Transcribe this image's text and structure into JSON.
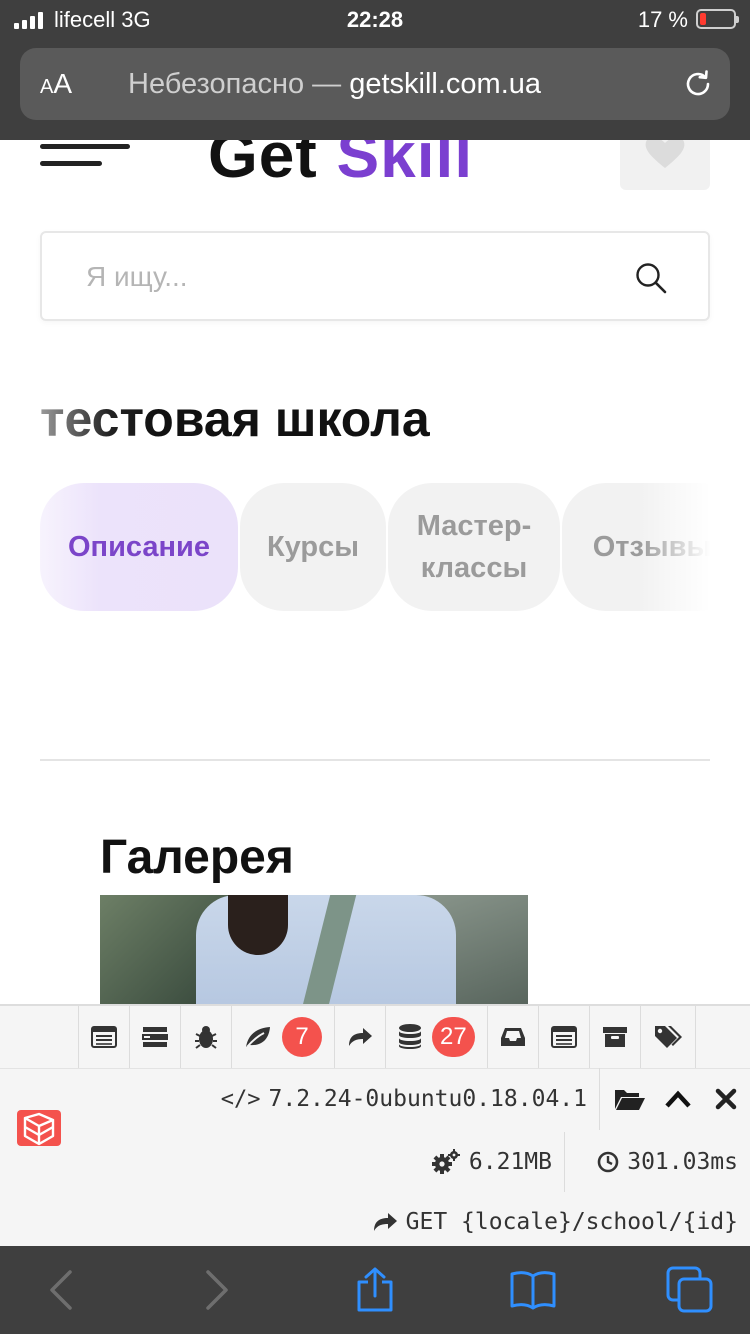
{
  "status_bar": {
    "carrier": "lifecell",
    "network": "3G",
    "time": "22:28",
    "battery_percent": "17 %",
    "battery_level": 0.17,
    "battery_color": "#ff3b30"
  },
  "address_bar": {
    "aa_label_small": "A",
    "aa_label_big": "A",
    "security_label": "Небезопасно —",
    "domain": "getskill.com.ua",
    "reload_icon": "reload-icon"
  },
  "header": {
    "menu_icon": "hamburger-menu-icon",
    "logo_part1": "Get",
    "logo_part2": "Skill",
    "logo_accent_color": "#7b3fd0",
    "favorites_icon": "heart-icon"
  },
  "search": {
    "placeholder": "Я ищу...",
    "value": "",
    "icon": "search-icon"
  },
  "school": {
    "title": "тестовая школа"
  },
  "tabs": [
    {
      "label": "Описание",
      "active": true
    },
    {
      "label": "Курсы",
      "active": false
    },
    {
      "label": "Мастер-\nклассы",
      "active": false
    },
    {
      "label": "Отзывы",
      "active": false
    }
  ],
  "gallery": {
    "title": "Галерея"
  },
  "debugbar": {
    "tabs": [
      {
        "icon": "messages-icon"
      },
      {
        "icon": "timeline-icon"
      },
      {
        "icon": "exceptions-bug-icon"
      },
      {
        "icon": "views-leaf-icon",
        "badge": "7"
      },
      {
        "icon": "route-share-icon"
      },
      {
        "icon": "queries-database-icon",
        "badge": "27"
      },
      {
        "icon": "mails-inbox-icon"
      },
      {
        "icon": "request-list-icon"
      },
      {
        "icon": "session-archive-icon"
      },
      {
        "icon": "models-tags-icon"
      }
    ],
    "php_version": "7.2.24-0ubuntu0.18.04.1",
    "memory": "6.21MB",
    "duration": "301.03ms",
    "route": "GET {locale}/school/{id}",
    "badge_color": "#f4524d",
    "logo_color": "#f4524d"
  },
  "bottom_toolbar": {
    "buttons": [
      "back-icon",
      "forward-icon",
      "share-icon",
      "bookmarks-icon",
      "tabs-icon"
    ],
    "active_color": "#2f8fff"
  }
}
